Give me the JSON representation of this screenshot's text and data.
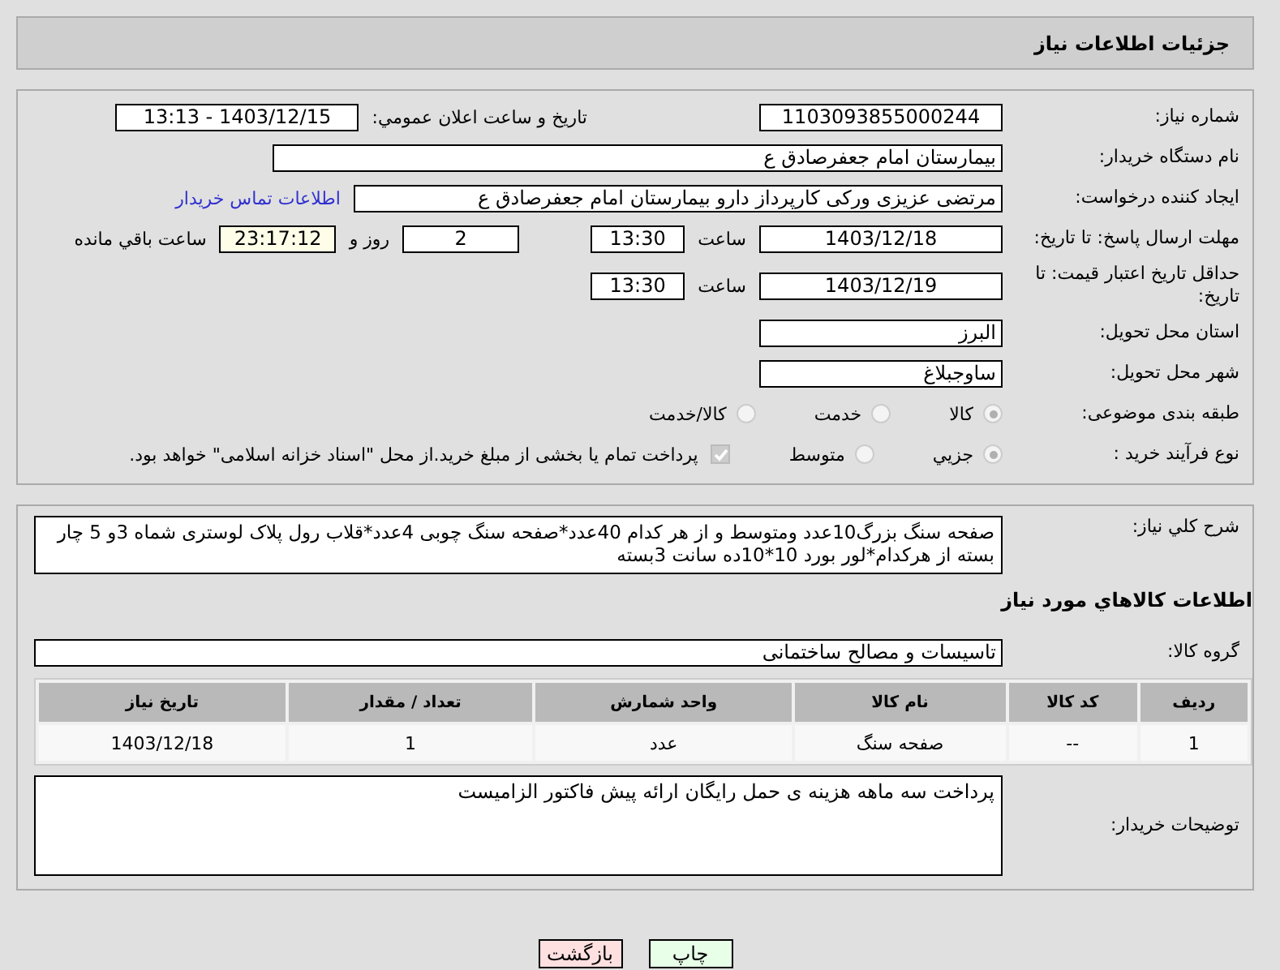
{
  "header": {
    "title": "جزئیات اطلاعات نیاز"
  },
  "need_number": {
    "label": "شماره نیاز:",
    "value": "1103093855000244"
  },
  "announce": {
    "label": "تاریخ و ساعت اعلان عمومي:",
    "value": "1403/12/15 - 13:13"
  },
  "buyer_org": {
    "label": "نام دستگاه خریدار:",
    "value": "بیمارستان امام جعفرصادق ع"
  },
  "creator": {
    "label": "ایجاد کننده درخواست:",
    "value": "مرتضی عزیزی ورکی کارپرداز دارو بیمارستان امام جعفرصادق ع",
    "link": "اطلاعات تماس خریدار"
  },
  "deadline": {
    "label": "مهلت ارسال پاسخ: تا تاریخ:",
    "date": "1403/12/18",
    "time_label": "ساعت",
    "time": "13:30",
    "days": "2",
    "days_label": "روز و",
    "remaining": "23:17:12",
    "remaining_label": "ساعت باقي مانده"
  },
  "price_validity": {
    "label": "حداقل تاریخ اعتبار قیمت: تا تاریخ:",
    "date": "1403/12/19",
    "time_label": "ساعت",
    "time": "13:30"
  },
  "province": {
    "label": "استان محل تحویل:",
    "value": "البرز"
  },
  "city": {
    "label": "شهر محل تحویل:",
    "value": "ساوجبلاغ"
  },
  "category": {
    "label": "طبقه بندی موضوعی:",
    "options": [
      {
        "label": "کالا",
        "selected": true
      },
      {
        "label": "خدمت",
        "selected": false
      },
      {
        "label": "کالا/خدمت",
        "selected": false
      }
    ]
  },
  "process": {
    "label": "نوع فرآیند خرید :",
    "options": [
      {
        "label": "جزیي",
        "selected": true
      },
      {
        "label": "متوسط",
        "selected": false
      }
    ],
    "treasury": {
      "checked": true,
      "label": "پرداخت تمام یا بخشی از مبلغ خرید.از محل \"اسناد خزانه اسلامی\" خواهد بود."
    }
  },
  "description": {
    "label": "شرح کلي نیاز:",
    "value": "صفحه سنگ بزرگ10عدد ومتوسط و از هر کدام 40عدد*صفحه سنگ چوبی 4عدد*قلاب رول پلاک لوستری شماه 3و 5 چار بسته از هرکدام*لور بورد 10*10ده سانت 3بسته"
  },
  "goods_heading": "اطلاعات کالاهاي مورد نیاز",
  "goods_group": {
    "label": "گروه کالا:",
    "value": "تاسیسات و مصالح ساختمانی"
  },
  "table": {
    "columns": [
      "ردیف",
      "کد کالا",
      "نام کالا",
      "واحد شمارش",
      "تعداد / مقدار",
      "تاریخ نیاز"
    ],
    "rows": [
      [
        "1",
        "--",
        "صفحه سنگ",
        "عدد",
        "1",
        "1403/12/18"
      ]
    ]
  },
  "buyer_notes": {
    "label": "توضیحات خریدار:",
    "value": "پرداخت سه ماهه هزینه ی حمل رایگان ارائه پیش فاکتور الزامیست"
  },
  "buttons": [
    {
      "kind": "print",
      "label": "چاپ"
    },
    {
      "kind": "back",
      "label": "بازگشت"
    }
  ]
}
